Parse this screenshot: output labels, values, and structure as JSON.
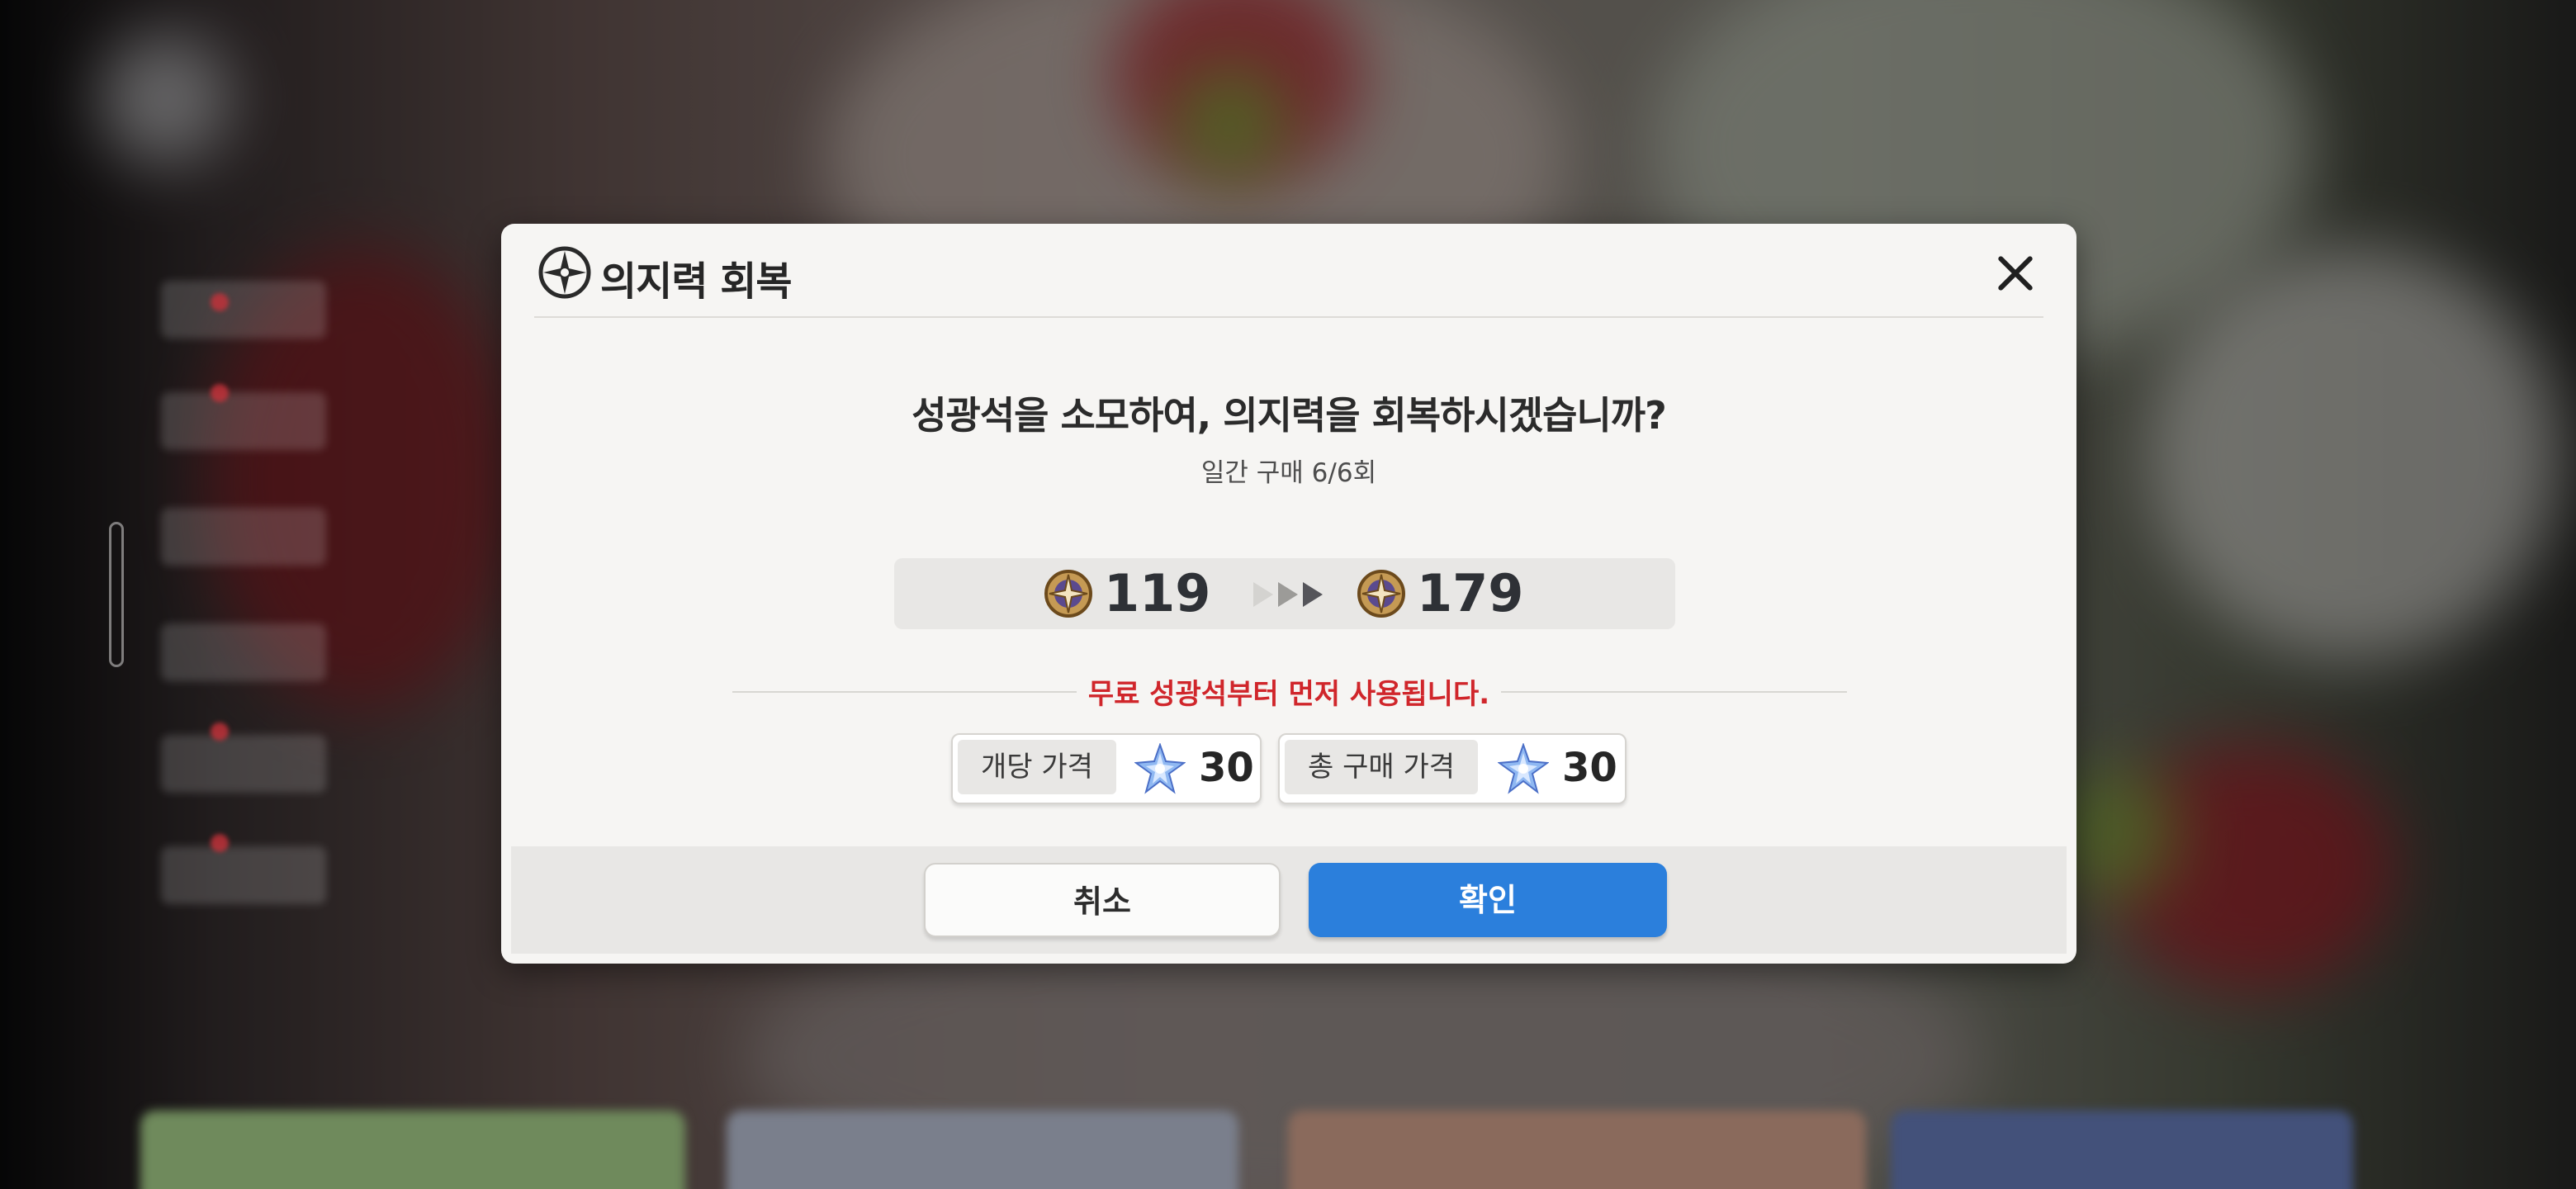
{
  "dialog": {
    "title": "의지력 회복",
    "question": "성광석을 소모하여, 의지력을 회복하시겠습니까?",
    "daily_purchase": "일간 구매 6/6회",
    "willpower_current": "119",
    "willpower_after": "179",
    "notice": "무료 성광석부터 먼저 사용됩니다.",
    "unit_price_label": "개당 가격",
    "unit_price_value": "30",
    "total_price_label": "총 구매 가격",
    "total_price_value": "30",
    "cancel_label": "취소",
    "confirm_label": "확인"
  },
  "icons": {
    "header": "compass-star-icon",
    "willpower": "willpower-compass-icon",
    "currency": "crystal-star-icon",
    "close": "close-icon",
    "arrows": "triple-arrow-icon"
  },
  "colors": {
    "confirm": "#2b7fdc",
    "notice": "#d0262b",
    "dialog_bg": "#f6f5f3"
  }
}
